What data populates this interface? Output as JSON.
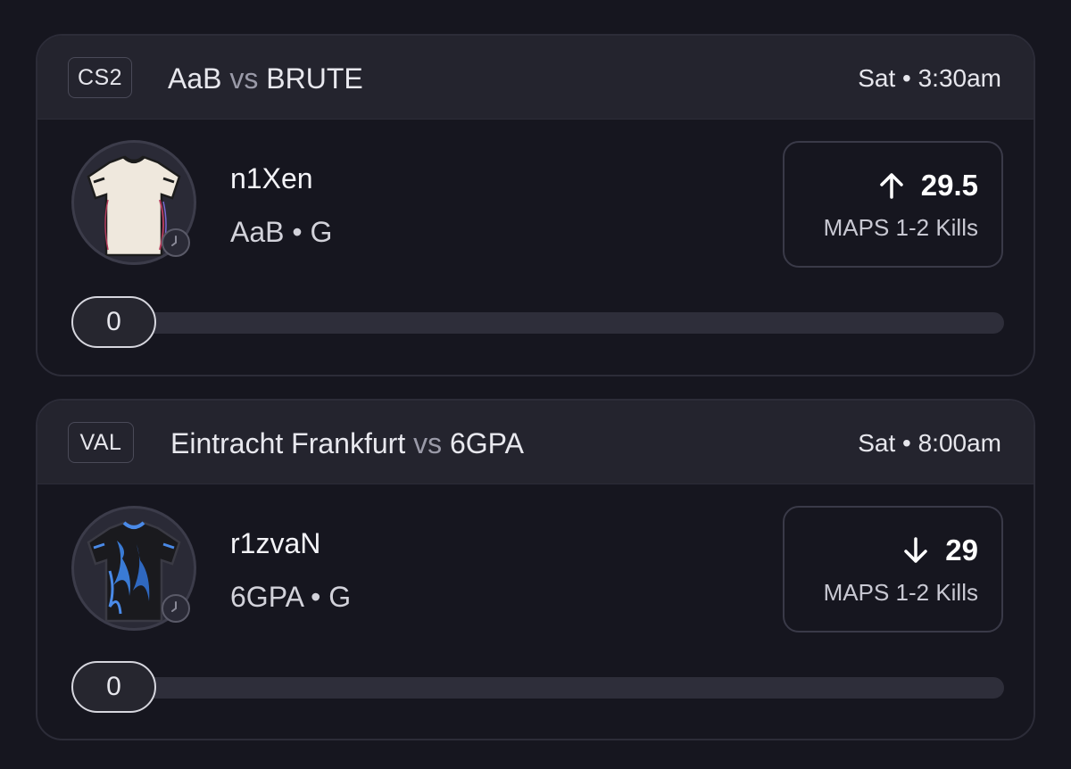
{
  "cards": [
    {
      "game": "CS2",
      "team_a": "AaB",
      "vs": "vs",
      "team_b": "BRUTE",
      "time": "Sat • 3:30am",
      "player": {
        "name": "n1Xen",
        "team_pos": "AaB • G",
        "avatar_icon": "jersey-icon",
        "status_icon": "clock-icon"
      },
      "stat": {
        "direction": "up",
        "arrow_icon": "arrow-up-icon",
        "value": "29.5",
        "label": "MAPS 1-2 Kills"
      },
      "progress": {
        "value": "0",
        "fraction": 0
      },
      "jersey_colors": {
        "body": "#efe8dd",
        "accent": "#b23a5a",
        "trim": "#222222"
      }
    },
    {
      "game": "VAL",
      "team_a": "Eintracht Frankfurt",
      "vs": "vs",
      "team_b": "6GPA",
      "time": "Sat • 8:00am",
      "player": {
        "name": "r1zvaN",
        "team_pos": "6GPA • G",
        "avatar_icon": "jersey-icon",
        "status_icon": "clock-icon"
      },
      "stat": {
        "direction": "down",
        "arrow_icon": "arrow-down-icon",
        "value": "29",
        "label": "MAPS 1-2 Kills"
      },
      "progress": {
        "value": "0",
        "fraction": 0
      },
      "jersey_colors": {
        "body": "#1a1a1e",
        "accent": "#3a7bd5",
        "trim": "#4a8ae8"
      }
    }
  ],
  "theme": {
    "background": "#16161f",
    "header_bg": "#24242e",
    "border": "#2c2c38",
    "text": "#ffffff",
    "muted_text": "#9a9aa8"
  }
}
